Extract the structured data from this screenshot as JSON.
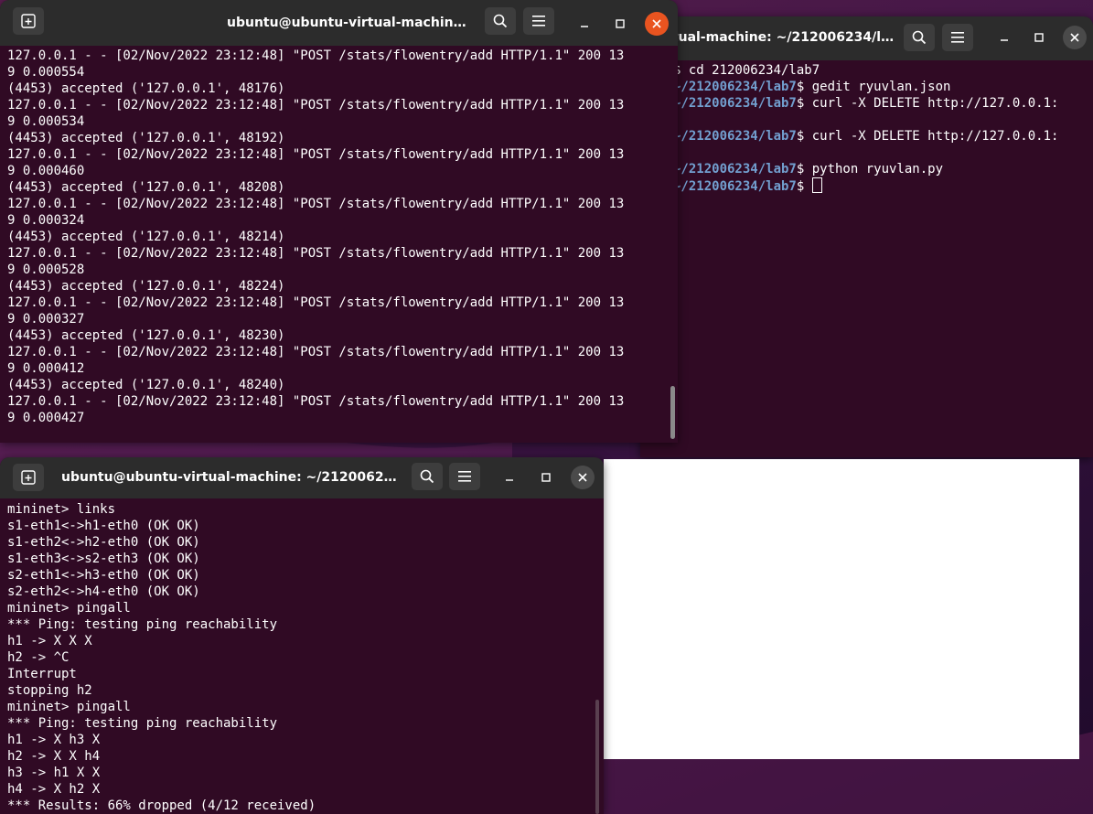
{
  "colors": {
    "terminal_bg": "#300a24",
    "titlebar_bg": "#2c2c2c",
    "prompt_path": "#729fcf",
    "close_accent": "#e95420"
  },
  "win_ryu": {
    "title": "ubuntu@ubuntu-virtual-machine: ~",
    "lines": [
      "127.0.0.1 - - [02/Nov/2022 23:12:48] \"POST /stats/flowentry/add HTTP/1.1\" 200 13",
      "9 0.000554",
      "(4453) accepted ('127.0.0.1', 48176)",
      "127.0.0.1 - - [02/Nov/2022 23:12:48] \"POST /stats/flowentry/add HTTP/1.1\" 200 13",
      "9 0.000534",
      "(4453) accepted ('127.0.0.1', 48192)",
      "127.0.0.1 - - [02/Nov/2022 23:12:48] \"POST /stats/flowentry/add HTTP/1.1\" 200 13",
      "9 0.000460",
      "(4453) accepted ('127.0.0.1', 48208)",
      "127.0.0.1 - - [02/Nov/2022 23:12:48] \"POST /stats/flowentry/add HTTP/1.1\" 200 13",
      "9 0.000324",
      "(4453) accepted ('127.0.0.1', 48214)",
      "127.0.0.1 - - [02/Nov/2022 23:12:48] \"POST /stats/flowentry/add HTTP/1.1\" 200 13",
      "9 0.000528",
      "(4453) accepted ('127.0.0.1', 48224)",
      "127.0.0.1 - - [02/Nov/2022 23:12:48] \"POST /stats/flowentry/add HTTP/1.1\" 200 13",
      "9 0.000327",
      "(4453) accepted ('127.0.0.1', 48230)",
      "127.0.0.1 - - [02/Nov/2022 23:12:48] \"POST /stats/flowentry/add HTTP/1.1\" 200 13",
      "9 0.000412",
      "(4453) accepted ('127.0.0.1', 48240)",
      "127.0.0.1 - - [02/Nov/2022 23:12:48] \"POST /stats/flowentry/add HTTP/1.1\" 200 13",
      "9 0.000427"
    ]
  },
  "win_lab7": {
    "title_visible": "rtual-machine: ~/212006234/lab7",
    "lines": [
      {
        "path": "",
        "text": "$ cd 212006234/lab7"
      },
      {
        "path": "~/212006234/lab7",
        "text": "$ gedit ryuvlan.json"
      },
      {
        "path": "~/212006234/lab7",
        "text": "$ curl -X DELETE http://127.0.0.1:"
      },
      {
        "path": "",
        "text": ""
      },
      {
        "path": "~/212006234/lab7",
        "text": "$ curl -X DELETE http://127.0.0.1:"
      },
      {
        "path": "",
        "text": ""
      },
      {
        "path": "~/212006234/lab7",
        "text": "$ python ryuvlan.py"
      },
      {
        "path": "~/212006234/lab7",
        "text": "$ "
      }
    ]
  },
  "win_mininet": {
    "title": "ubuntu@ubuntu-virtual-machine: ~/212006234/la...",
    "lines": [
      "mininet> links",
      "s1-eth1<->h1-eth0 (OK OK)",
      "s1-eth2<->h2-eth0 (OK OK)",
      "s1-eth3<->s2-eth3 (OK OK)",
      "s2-eth1<->h3-eth0 (OK OK)",
      "s2-eth2<->h4-eth0 (OK OK)",
      "mininet> pingall",
      "*** Ping: testing ping reachability",
      "h1 -> X X X",
      "h2 -> ^C",
      "Interrupt",
      "stopping h2",
      "mininet> pingall",
      "*** Ping: testing ping reachability",
      "h1 -> X h3 X",
      "h2 -> X X h4",
      "h3 -> h1 X X",
      "h4 -> X h2 X",
      "*** Results: 66% dropped (4/12 received)"
    ]
  },
  "icons": {
    "new_tab": "new-tab-icon",
    "search": "search-icon",
    "menu": "hamburger-menu-icon",
    "minimize": "minimize-icon",
    "maximize": "maximize-icon",
    "close": "close-icon"
  }
}
